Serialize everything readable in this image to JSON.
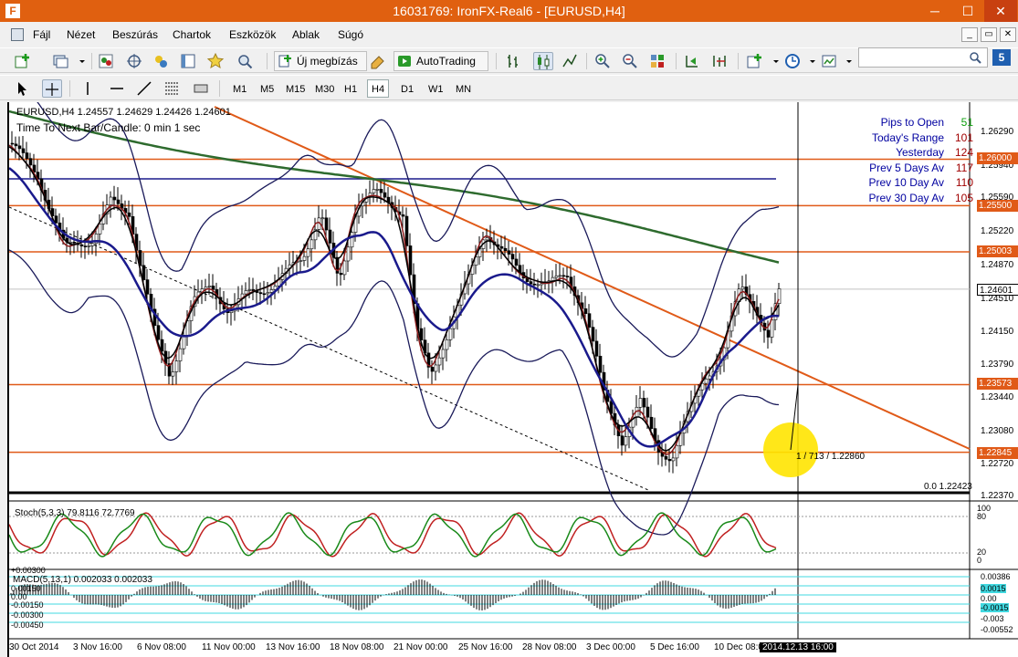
{
  "window": {
    "title": "16031769: IronFX-Real6 - [EURUSD,H4]",
    "icon_letter": "F",
    "minimize": "─",
    "maximize": "☐",
    "close": "✕"
  },
  "menu": {
    "items": [
      "Fájl",
      "Nézet",
      "Beszúrás",
      "Chartok",
      "Eszközök",
      "Ablak",
      "Súgó"
    ],
    "mdi": [
      "_",
      "▭",
      "✕"
    ]
  },
  "toolbar": {
    "new_order_label": "Új megbízás",
    "autotrading_label": "AutoTrading",
    "search_placeholder": "",
    "help_label": "5"
  },
  "timeframes": {
    "items": [
      "M1",
      "M5",
      "M15",
      "M30",
      "H1",
      "H4",
      "D1",
      "W1",
      "MN"
    ],
    "active": "H4"
  },
  "chart": {
    "symbol_header": "EURUSD,H4 1.24557 1.24629 1.24426 1.24601",
    "timer_text": "Time To Next Bar/Candle: 0 min 1 sec",
    "crosshair_label": "1 / 713 / 1.22860",
    "fib_label": "0.0 1.22423",
    "time_highlight": "2014.12.13 16:00",
    "stoch_label": "Stoch(5,3,3) 79.8116 72.7769",
    "macd_label": "MACD(5,13,1) 0.002033 0.002033",
    "colors": {
      "level_line": "#e05a18",
      "trend_line": "#e05a18",
      "ma_slow": "#2e6b2e",
      "ma_mid": "#1a1a8c",
      "bands": "#1a1a5a",
      "candles": "#000000",
      "stoch_main": "#1a8a1a",
      "stoch_signal": "#c02020",
      "macd_levels": "#40d8e0",
      "highlight": "#ffe400"
    }
  },
  "info_panel": [
    {
      "label": "Pips to Open",
      "value": "51",
      "color": "green"
    },
    {
      "label": "Today's Range",
      "value": "101"
    },
    {
      "label": "Yesterday",
      "value": "124"
    },
    {
      "label": "Prev 5 Days Av",
      "value": "117"
    },
    {
      "label": "Prev 10 Day Av",
      "value": "110"
    },
    {
      "label": "Prev 30 Day Av",
      "value": "105"
    }
  ],
  "price_axis": {
    "labels": [
      "1.26290",
      "1.25940",
      "1.25590",
      "1.25220",
      "1.24870",
      "1.24510",
      "1.24150",
      "1.23790",
      "1.23440",
      "1.23080",
      "1.22720",
      "1.22370"
    ],
    "tags": [
      {
        "value": "1.26000",
        "kind": "level"
      },
      {
        "value": "1.25500",
        "kind": "level"
      },
      {
        "value": "1.25003",
        "kind": "level"
      },
      {
        "value": "1.24601",
        "kind": "current"
      },
      {
        "value": "1.23573",
        "kind": "level"
      },
      {
        "value": "1.22845",
        "kind": "level"
      }
    ]
  },
  "stoch_axis": [
    "100",
    "80",
    "20",
    "0"
  ],
  "macd_axis": [
    "0.00386",
    "0.0015",
    "0.00",
    "-0.0015",
    "-0.003",
    "-0.00552"
  ],
  "macd_left_labels": [
    "+0.00300",
    "0.00150",
    "0.00",
    "-0.00150",
    "-0.00300",
    "-0.00450"
  ],
  "time_axis": [
    "30 Oct 2014",
    "3 Nov 16:00",
    "6 Nov 08:00",
    "11 Nov 00:00",
    "13 Nov 16:00",
    "18 Nov 08:00",
    "21 Nov 00:00",
    "25 Nov 16:00",
    "28 Nov 08:00",
    "3 Dec 00:00",
    "5 Dec 16:00",
    "10 Dec 08:00"
  ]
}
